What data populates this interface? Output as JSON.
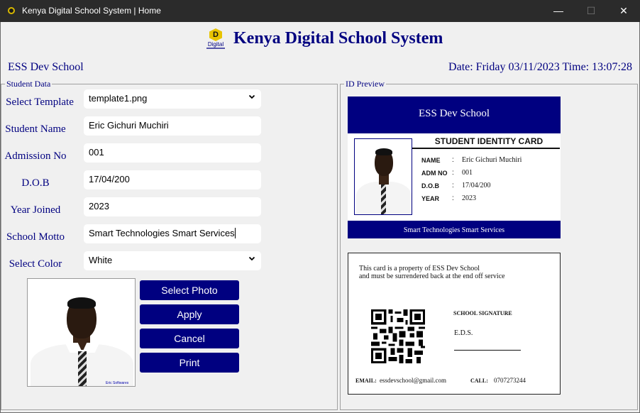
{
  "window": {
    "title": "Kenya Digital School System | Home",
    "minimize_glyph": "—",
    "maximize_glyph": "☐",
    "close_glyph": "✕"
  },
  "header": {
    "logo_letter": "D",
    "logo_caption": "Digital",
    "app_title": "Kenya Digital School System",
    "school_name": "ESS Dev School",
    "datetime": "Date: Friday 03/11/2023 Time: 13:07:28"
  },
  "student_data": {
    "legend": "Student Data",
    "fields": [
      {
        "label": "Select Template",
        "value": "template1.png",
        "type": "dropdown"
      },
      {
        "label": "Student Name",
        "value": "Eric Gichuri Muchiri",
        "type": "text"
      },
      {
        "label": "Admission No",
        "value": "001",
        "type": "text"
      },
      {
        "label": "D.O.B",
        "value": "17/04/200",
        "type": "text"
      },
      {
        "label": "Year Joined",
        "value": "2023",
        "type": "text"
      },
      {
        "label": "School Motto",
        "value": "Smart Technologies Smart Services",
        "type": "text"
      },
      {
        "label": "Select Color",
        "value": "White",
        "type": "dropdown"
      }
    ],
    "dropdown_icon": "chevron-down",
    "photo_watermark": "Eric Softwares",
    "buttons": {
      "select_photo": "Select Photo",
      "apply": "Apply",
      "cancel": "Cancel",
      "print": "Print"
    }
  },
  "id_preview": {
    "legend": "ID Preview",
    "front": {
      "school_name": "ESS Dev School",
      "card_title": "STUDENT IDENTITY CARD",
      "rows": [
        {
          "key": "NAME",
          "value": "Eric Gichuri Muchiri"
        },
        {
          "key": "ADM NO",
          "value": "001"
        },
        {
          "key": "D.O.B",
          "value": "17/04/200"
        },
        {
          "key": "YEAR",
          "value": "2023"
        }
      ],
      "colon": ":",
      "motto": "Smart Technologies Smart Services",
      "band_color": "#000080"
    },
    "back": {
      "property_line1": "This card is a property of ESS Dev School",
      "property_line2": "and must be surrendered back at the end off service",
      "signature_label": "SCHOOL SIGNATURE",
      "signature_value": "E.D.S.",
      "email_label": "EMAIL:",
      "email_value": "essdevschool@gmail.com",
      "call_label": "CALL:",
      "call_value": "0707273244",
      "qr_icon": "qr-code"
    }
  },
  "colors": {
    "accent": "#000080",
    "titlebar": "#2b2b2b",
    "background": "#f0f0f0"
  }
}
